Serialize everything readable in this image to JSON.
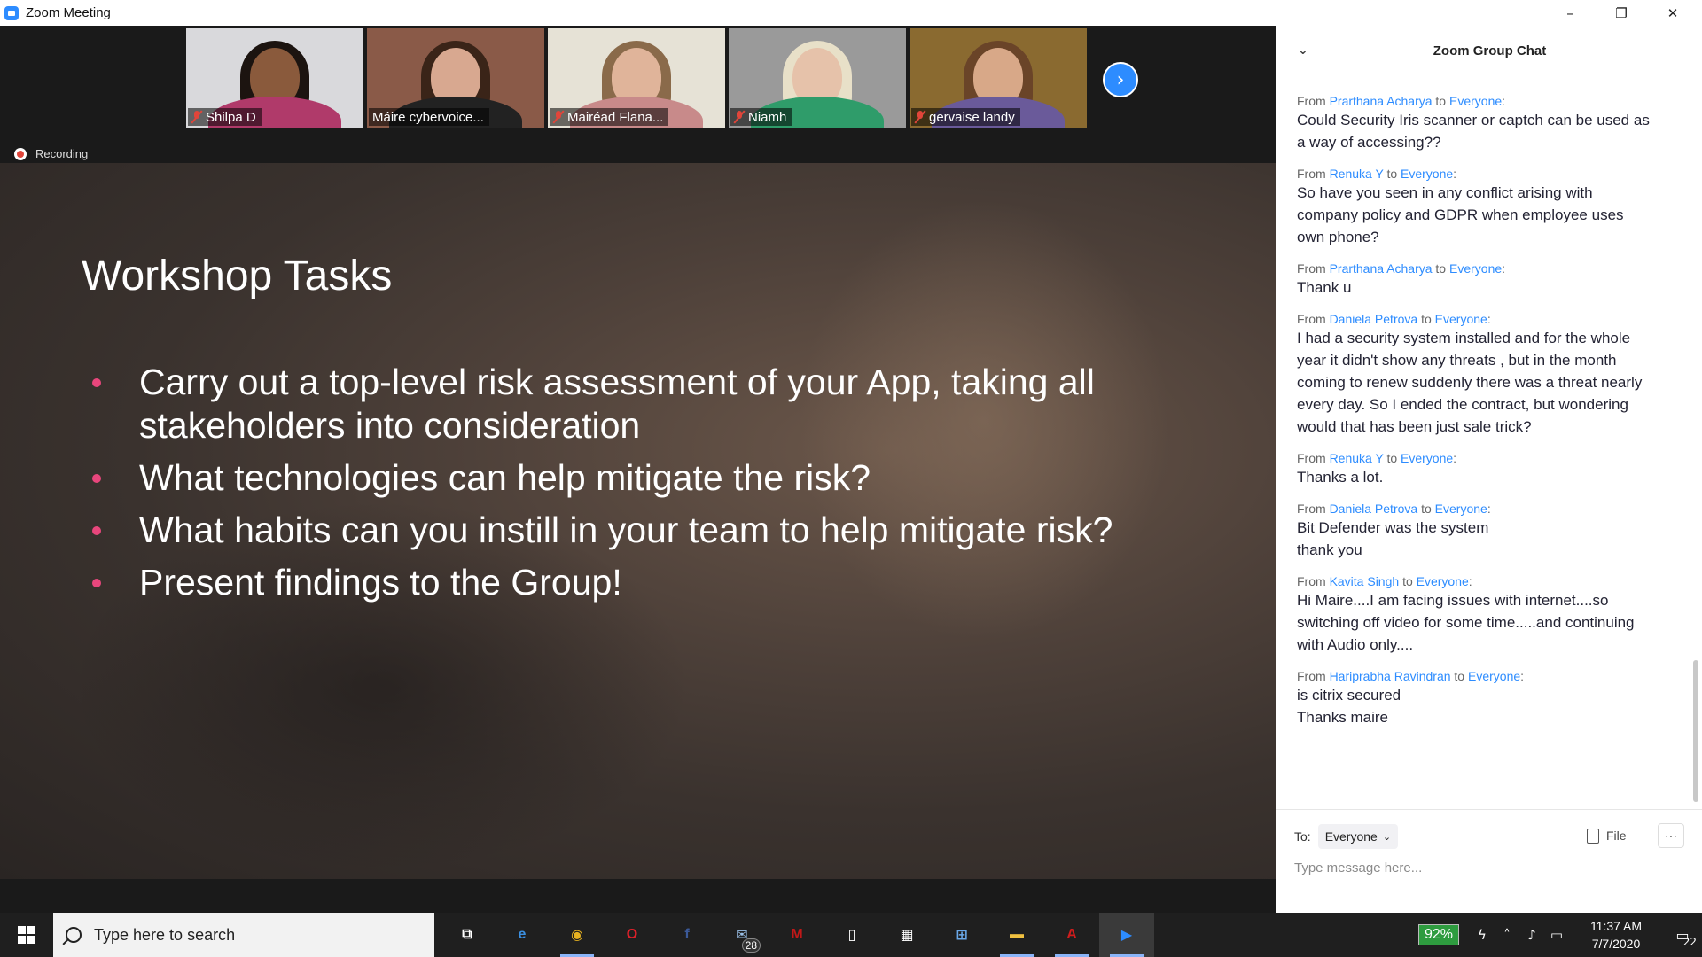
{
  "window": {
    "title": "Zoom Meeting",
    "controls": [
      "–",
      "❐",
      "✕"
    ]
  },
  "participants": [
    {
      "name": "Shilpa D",
      "muted": true,
      "bg": "#d9d9dc",
      "skin": "#8a5a3c",
      "hair": "#1c1410",
      "shirt": "#b03a6a"
    },
    {
      "name": "Máire cybervoice...",
      "muted": false,
      "bg": "#8a5a48",
      "skin": "#d8a890",
      "hair": "#3a2418",
      "shirt": "#222222",
      "active": true
    },
    {
      "name": "Mairéad Flana...",
      "muted": true,
      "bg": "#e6e2d6",
      "skin": "#e0b49a",
      "hair": "#8a6a4a",
      "shirt": "#c88a8a"
    },
    {
      "name": "Niamh",
      "muted": true,
      "bg": "#9a9a9a",
      "skin": "#e6c2aa",
      "hair": "#e8e0c8",
      "shirt": "#2f9c6a"
    },
    {
      "name": "gervaise landy",
      "muted": true,
      "bg": "#8a6a30",
      "skin": "#d8a888",
      "hair": "#6a4428",
      "shirt": "#6a5a9a"
    }
  ],
  "recording_label": "Recording",
  "slide": {
    "title": "Workshop Tasks",
    "bullets": [
      "Carry out a top-level risk assessment of your App, taking all stakeholders into consideration",
      "What technologies can help mitigate the risk?",
      "What habits can you instill in your team to help mitigate risk?",
      "Present findings to the Group!"
    ]
  },
  "chat": {
    "title": "Zoom Group Chat",
    "messages": [
      {
        "from": "Prarthana Acharya",
        "to": "Everyone",
        "lines": [
          "Could Security Iris scanner or captch can be used as a way of accessing??"
        ]
      },
      {
        "from": "Renuka Y",
        "to": "Everyone",
        "lines": [
          "So have you seen in any conflict arising with company policy and GDPR  when employee uses own phone?"
        ]
      },
      {
        "from": "Prarthana Acharya",
        "to": "Everyone",
        "lines": [
          "Thank u"
        ]
      },
      {
        "from": "Daniela Petrova",
        "to": "Everyone",
        "lines": [
          "I had a security system installed and for the whole year it didn't show any threats , but in the month coming to renew suddenly there was a threat nearly every day.  So I ended the contract, but wondering would that has been just sale trick?"
        ]
      },
      {
        "from": "Renuka Y",
        "to": "Everyone",
        "lines": [
          "Thanks a lot."
        ]
      },
      {
        "from": "Daniela Petrova",
        "to": "Everyone",
        "lines": [
          "Bit Defender was the system",
          "thank you"
        ]
      },
      {
        "from": "Kavita Singh",
        "to": "Everyone",
        "lines": [
          "Hi Maire....I am facing issues with internet....so switching off video for some time.....and continuing with Audio only...."
        ]
      },
      {
        "from": "Hariprabha Ravindran",
        "to": "Everyone",
        "lines": [
          "is citrix secured",
          "Thanks maire"
        ]
      }
    ],
    "from_word": "From",
    "to_word": "to",
    "to_label": "To:",
    "recipient": "Everyone",
    "file_label": "File",
    "more_label": "···",
    "input_placeholder": "Type message here..."
  },
  "taskbar": {
    "search_placeholder": "Type here to search",
    "apps": [
      {
        "name": "task-view",
        "glyph": "⧉",
        "color": "#ffffff",
        "running": false
      },
      {
        "name": "edge",
        "glyph": "e",
        "color": "#3b8fe0",
        "running": false
      },
      {
        "name": "chrome",
        "glyph": "◉",
        "color": "#e8b320",
        "running": true
      },
      {
        "name": "opera",
        "glyph": "O",
        "color": "#e0202a",
        "running": false
      },
      {
        "name": "facebook",
        "glyph": "f",
        "color": "#3b5998",
        "running": false
      },
      {
        "name": "mail",
        "glyph": "✉",
        "color": "#9ac0e8",
        "running": false,
        "badge": "28"
      },
      {
        "name": "mcafee",
        "glyph": "M",
        "color": "#c01818",
        "running": false
      },
      {
        "name": "notepad",
        "glyph": "▯",
        "color": "#ffffff",
        "running": false
      },
      {
        "name": "store",
        "glyph": "▦",
        "color": "#ffffff",
        "running": false
      },
      {
        "name": "network",
        "glyph": "⊞",
        "color": "#6aa8e8",
        "running": false
      },
      {
        "name": "file-explorer",
        "glyph": "▬",
        "color": "#f0c040",
        "running": true
      },
      {
        "name": "acrobat",
        "glyph": "A",
        "color": "#d01c1c",
        "running": true
      },
      {
        "name": "zoom",
        "glyph": "▶",
        "color": "#2d8cff",
        "running": true,
        "active": true
      }
    ],
    "battery": "92%",
    "time": "11:37 AM",
    "date": "7/7/2020",
    "notifications": "22"
  }
}
